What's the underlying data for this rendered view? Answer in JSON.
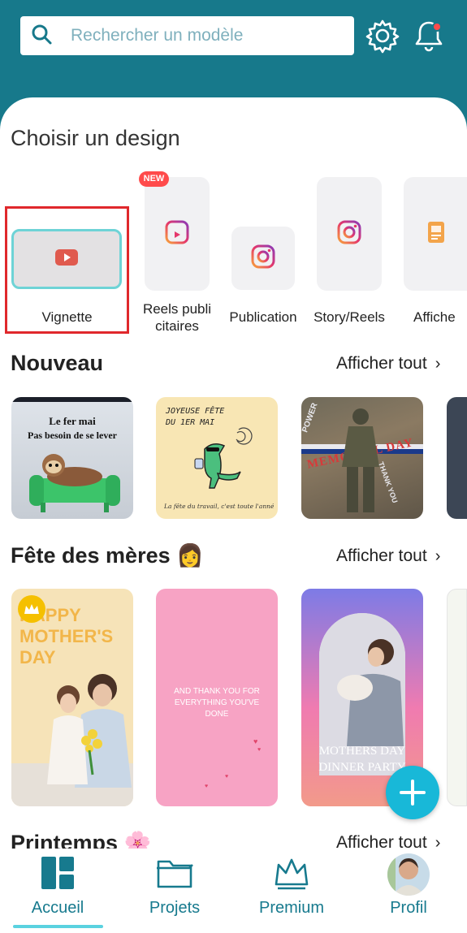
{
  "search": {
    "placeholder": "Rechercher un modèle"
  },
  "sections": {
    "choose_design": "Choisir un design",
    "new": "Nouveau",
    "mothers_day": "Fête des mères 👩",
    "spring": "Printemps 🌸",
    "see_all": "Afficher tout"
  },
  "formats": [
    {
      "label": "Vignette",
      "icon": "youtube-icon"
    },
    {
      "label": "Reels publi citaires",
      "icon": "reels-icon",
      "badge": "NEW"
    },
    {
      "label": "Publication",
      "icon": "instagram-icon"
    },
    {
      "label": "Story/Reels",
      "icon": "instagram-icon"
    },
    {
      "label": "Affiche",
      "icon": "poster-icon"
    }
  ],
  "new_cards": [
    {
      "line1": "Le fer mai",
      "line2": "Pas besoin de se lever"
    },
    {
      "line1": "JOYEUSE FÊTE",
      "line2": "DU 1ER MAI",
      "line3": "La fête du travail, c'est toute l'année"
    },
    {
      "title": "MEMORIAL DAY",
      "side1": "POWER",
      "side2": "THANK YOU"
    }
  ],
  "mother_cards": [
    {
      "text": "HAPPY MOTHER'S DAY",
      "premium": true
    },
    {
      "text": "AND THANK YOU FOR EVERYTHING YOU'VE DONE"
    },
    {
      "text": "MOTHERS DAY DINNER PARTY"
    }
  ],
  "nav": [
    {
      "label": "Accueil",
      "icon": "home-grid-icon",
      "active": true
    },
    {
      "label": "Projets",
      "icon": "folder-icon"
    },
    {
      "label": "Premium",
      "icon": "crown-icon"
    },
    {
      "label": "Profil",
      "icon": "avatar"
    }
  ],
  "colors": {
    "brand": "#17798b",
    "accent": "#18b8d8",
    "badge": "#ff4b4b",
    "highlight": "#e0282c"
  }
}
